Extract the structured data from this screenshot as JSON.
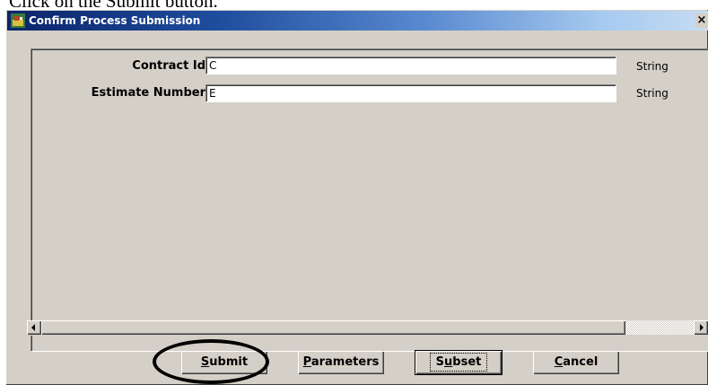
{
  "caption": {
    "text": "Click on the Submit button."
  },
  "window": {
    "title": "Confirm Process Submission",
    "close_glyph": "×",
    "app_icon": "application-icon"
  },
  "form": {
    "rows": [
      {
        "label": "Contract Id",
        "value": "C",
        "type": "String"
      },
      {
        "label": "Estimate Number",
        "value": "E",
        "type": "String"
      }
    ]
  },
  "buttons": {
    "submit": {
      "mnemonic": "S",
      "rest": "ubmit"
    },
    "parameters": {
      "mnemonic": "P",
      "rest": "arameters"
    },
    "subset": {
      "first": "S",
      "mnemonic": "u",
      "rest": "bset"
    },
    "cancel": {
      "mnemonic": "C",
      "rest": "ancel"
    }
  },
  "annotation": {
    "shape": "ellipse",
    "target": "submit-button"
  }
}
